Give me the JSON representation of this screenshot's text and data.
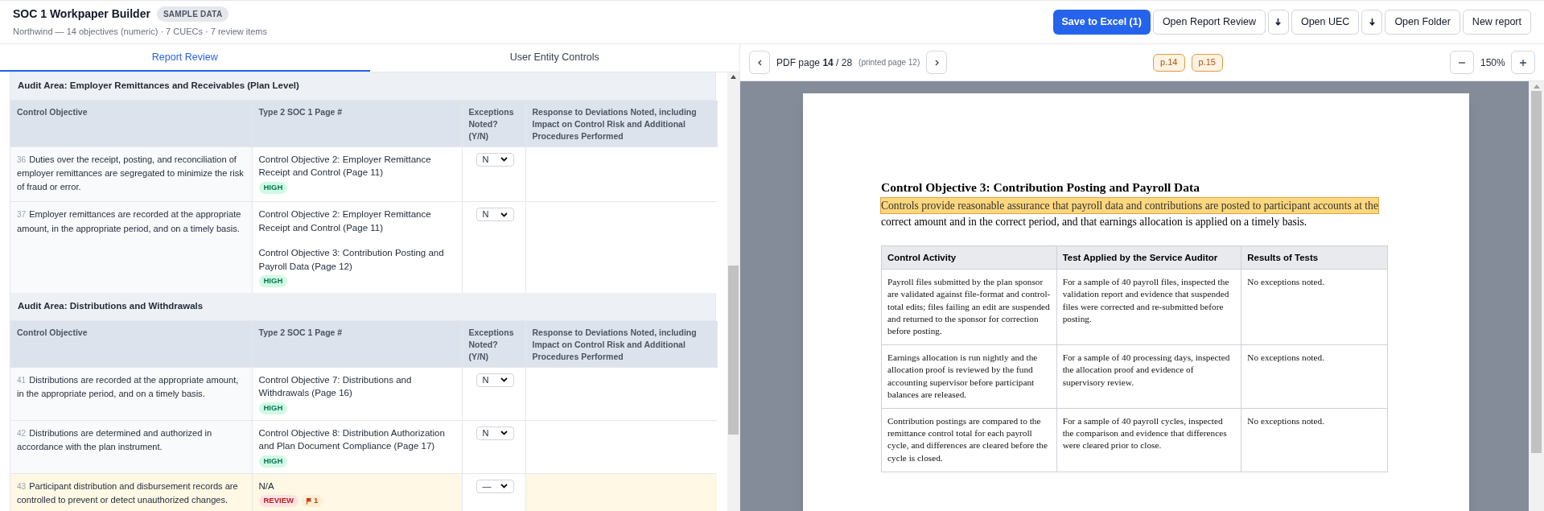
{
  "header": {
    "title": "SOC 1 Workpaper Builder",
    "badge": "SAMPLE DATA",
    "subtitle": "Northwind — 14 objectives (numeric) · 7 CUECs · 7 review items"
  },
  "actions": [
    {
      "kind": "primary",
      "label": "Save to Excel (1)"
    },
    {
      "kind": "default",
      "label": "Open Report Review"
    },
    {
      "kind": "download"
    },
    {
      "kind": "default",
      "label": "Open UEC"
    },
    {
      "kind": "download"
    },
    {
      "kind": "default",
      "label": "Open Folder"
    },
    {
      "kind": "default",
      "label": "New report"
    }
  ],
  "tabs": [
    {
      "label": "Report Review",
      "selected": true
    },
    {
      "label": "User Entity Controls",
      "selected": false
    }
  ],
  "sections": [
    {
      "title": "Audit Area: Employer Remittances and Receivables (Plan Level)",
      "columns": [
        "Control Objective",
        "Type 2 SOC 1 Page #",
        "Exceptions Noted? (Y/N)",
        "Response to Deviations Noted, including Impact on Control Risk and Additional Procedures Performed"
      ],
      "rows": [
        {
          "number": "36",
          "objective": "Duties over the receipt, posting, and reconciliation of employer remittances are segregated to minimize the risk of fraud or error.",
          "references": [
            "Control Objective 2: Employer Remittance Receipt and Control (Page 11)"
          ],
          "badges": [
            {
              "kind": "high",
              "label": "HIGH"
            }
          ],
          "exceptions": "N",
          "needs_review": false
        },
        {
          "number": "37",
          "objective": "Employer remittances are recorded at the appropriate amount, in the appropriate period, and on a timely basis.",
          "references": [
            "Control Objective 2: Employer Remittance Receipt and Control (Page 11)",
            "Control Objective 3: Contribution Posting and Payroll Data (Page 12)"
          ],
          "badges": [
            {
              "kind": "high",
              "label": "HIGH"
            }
          ],
          "exceptions": "N",
          "needs_review": false
        }
      ]
    },
    {
      "title": "Audit Area: Distributions and Withdrawals",
      "columns": [
        "Control Objective",
        "Type 2 SOC 1 Page #",
        "Exceptions Noted? (Y/N)",
        "Response to Deviations Noted, including Impact on Control Risk and Additional Procedures Performed"
      ],
      "rows": [
        {
          "number": "41",
          "objective": "Distributions are recorded at the appropriate amount, in the appropriate period, and on a timely basis.",
          "references": [
            "Control Objective 7: Distributions and Withdrawals (Page 16)"
          ],
          "badges": [
            {
              "kind": "high",
              "label": "HIGH"
            }
          ],
          "exceptions": "N",
          "needs_review": false
        },
        {
          "number": "42",
          "objective": "Distributions are determined and authorized in accordance with the plan instrument.",
          "references": [
            "Control Objective 8: Distribution Authorization and Plan Document Compliance (Page 17)"
          ],
          "badges": [
            {
              "kind": "high",
              "label": "HIGH"
            }
          ],
          "exceptions": "N",
          "needs_review": false
        },
        {
          "number": "43",
          "objective": "Participant distribution and disbursement records are controlled to prevent or detect unauthorized changes.",
          "references": [
            "N/A"
          ],
          "badges": [
            {
              "kind": "review",
              "label": "REVIEW"
            },
            {
              "kind": "flag",
              "label": "1"
            }
          ],
          "exceptions": "—",
          "needs_review": true
        }
      ]
    }
  ],
  "viewer": {
    "page_label": "PDF page **14** / 28",
    "printed_page": "(printed page 12)",
    "page_chips": [
      "p.14",
      "p.15"
    ],
    "zoom": "150%"
  },
  "document": {
    "heading": "Control Objective 3: Contribution Posting and Payroll Data",
    "highlighted_text": "Controls provide reasonable assurance that payroll data and contributions are posted to participant accounts at the",
    "text": "correct amount and in the correct period, and that earnings allocation is applied on a timely basis.",
    "table": {
      "columns": [
        "Control Activity",
        "Test Applied by the Service Auditor",
        "Results of Tests"
      ],
      "rows": [
        [
          "Payroll files submitted by the plan sponsor are validated against file-format and control-total edits; files failing an edit are suspended and returned to the sponsor for correction before posting.",
          "For a sample of 40 payroll files, inspected the validation report and evidence that suspended files were corrected and re-submitted before posting.",
          "No exceptions noted."
        ],
        [
          "Earnings allocation is run nightly and the allocation proof is reviewed by the fund accounting supervisor before participant balances are released.",
          "For a sample of 40 processing days, inspected the allocation proof and evidence of supervisory review.",
          "No exceptions noted."
        ],
        [
          "Contribution postings are compared to the remittance control total for each payroll cycle, and differences are cleared before the cycle is closed.",
          "For a sample of 40 payroll cycles, inspected the comparison and evidence that differences were cleared prior to close.",
          "No exceptions noted."
        ]
      ]
    }
  }
}
